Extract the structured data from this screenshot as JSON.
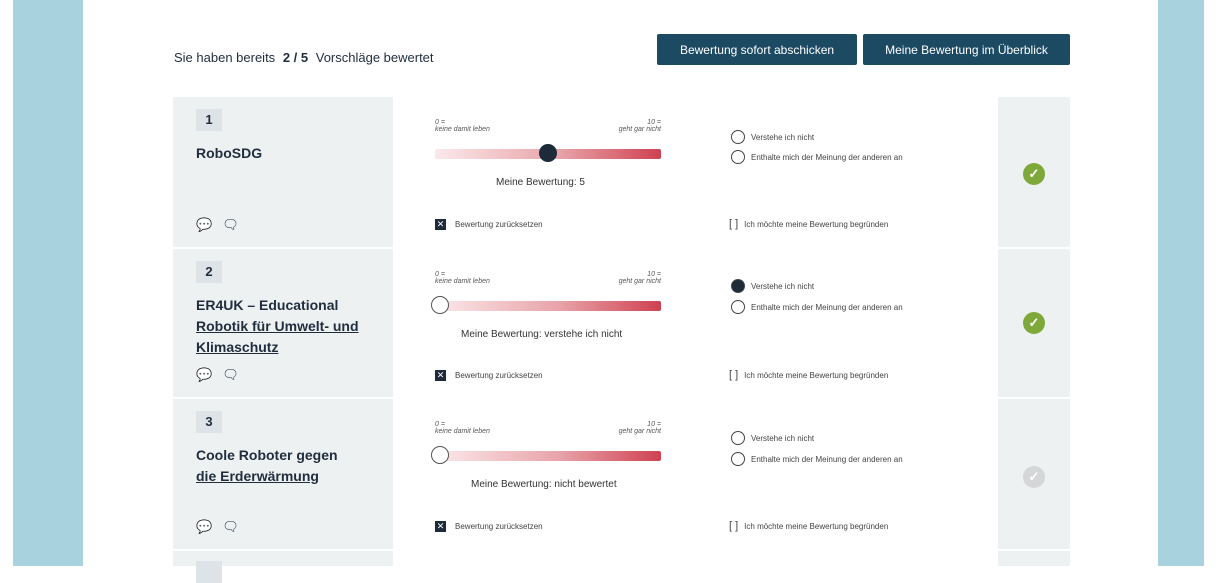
{
  "summary": {
    "prefix": "Sie haben bereits",
    "count": "2 / 5",
    "suffix": "Vorschläge bewertet"
  },
  "buttons": {
    "submit": "Bewertung sofort abschicken",
    "overview": "Meine Bewertung im Überblick"
  },
  "scale": {
    "low": "0 =\nkeine damit leben",
    "high": "10 =\ngeht gar nicht"
  },
  "proposals": [
    {
      "num": "1",
      "title_plain": "RoboSDG",
      "title_link": "",
      "rating_value": 5,
      "rating_text": "Meine Bewertung: 5",
      "radio1": "Verstehe ich nicht",
      "radio2": "Enthalte mich der Meinung der anderen an",
      "checkbox": "Bewertung zurücksetzen",
      "justify": "Ich möchte meine Bewertung begründen",
      "status": "rated"
    },
    {
      "num": "2",
      "title_plain": "ER4UK – Educational",
      "title_link": "Robotik für Umwelt- und Klimaschutz",
      "rating_value": null,
      "rating_text": "Meine Bewertung: verstehe ich nicht",
      "radio1": "Verstehe ich nicht",
      "radio2": "Enthalte mich der Meinung der anderen an",
      "checkbox": "Bewertung zurücksetzen",
      "justify": "Ich möchte meine Bewertung begründen",
      "status": "rated"
    },
    {
      "num": "3",
      "title_plain": "Coole Roboter gegen",
      "title_link": "die Erderwärmung",
      "rating_value": null,
      "rating_text": "Meine Bewertung: nicht bewertet",
      "radio1": "Verstehe ich nicht",
      "radio2": "Enthalte mich der Meinung der anderen an",
      "checkbox": "Bewertung zurücksetzen",
      "justify": "Ich möchte meine Bewertung begründen",
      "status": "unrated"
    }
  ],
  "icons": {
    "tooltip": "speech-bubble-icon",
    "comments": "comments-icon",
    "check": "check-circle-icon"
  }
}
